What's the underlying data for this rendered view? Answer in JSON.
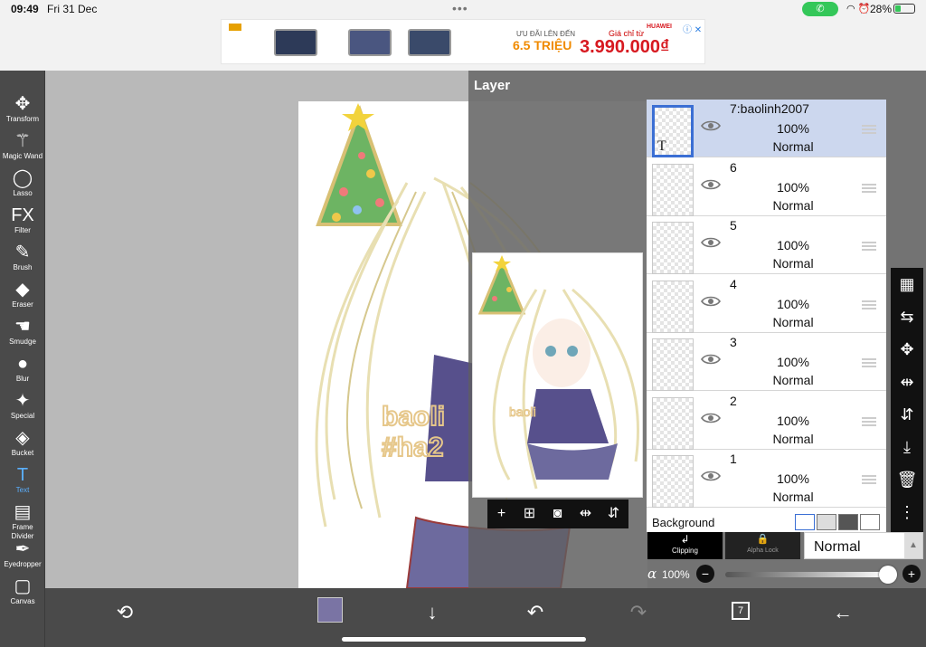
{
  "status_bar": {
    "time": "09:49",
    "date": "Fri 31 Dec",
    "battery": "28%",
    "battery_fraction": 0.28
  },
  "ad": {
    "promo_small": "ƯU ĐÃI LÊN ĐẾN",
    "promo_big": "6.5 TRIỆU",
    "price_small": "Giá chỉ từ",
    "price_big": "3.990.000₫",
    "brand": "HUAWEI",
    "accent": "#d71920"
  },
  "tools": [
    {
      "label": "Transform",
      "icon": "transform-icon",
      "glyph": "✥"
    },
    {
      "label": "Magic Wand",
      "icon": "magic-wand-icon",
      "glyph": "⚚"
    },
    {
      "label": "Lasso",
      "icon": "lasso-icon",
      "glyph": "◯"
    },
    {
      "label": "Filter",
      "icon": "filter-icon",
      "glyph": "FX"
    },
    {
      "label": "Brush",
      "icon": "brush-icon",
      "glyph": "✎"
    },
    {
      "label": "Eraser",
      "icon": "eraser-icon",
      "glyph": "◆"
    },
    {
      "label": "Smudge",
      "icon": "smudge-icon",
      "glyph": "☚"
    },
    {
      "label": "Blur",
      "icon": "blur-icon",
      "glyph": "●"
    },
    {
      "label": "Special",
      "icon": "special-icon",
      "glyph": "✦"
    },
    {
      "label": "Bucket",
      "icon": "bucket-icon",
      "glyph": "◈"
    },
    {
      "label": "Text",
      "icon": "text-icon",
      "glyph": "T",
      "active": true
    },
    {
      "label": "Frame Divider",
      "icon": "frame-divider-icon",
      "glyph": "▤"
    },
    {
      "label": "Eyedropper",
      "icon": "eyedropper-icon",
      "glyph": "✒"
    },
    {
      "label": "Canvas",
      "icon": "canvas-icon",
      "glyph": "▢"
    }
  ],
  "layer_panel": {
    "title": "Layer",
    "layers": [
      {
        "name": "7:baolinh2007",
        "opacity": "100%",
        "mode": "Normal",
        "selected": true
      },
      {
        "name": "6",
        "opacity": "100%",
        "mode": "Normal"
      },
      {
        "name": "5",
        "opacity": "100%",
        "mode": "Normal"
      },
      {
        "name": "4",
        "opacity": "100%",
        "mode": "Normal"
      },
      {
        "name": "3",
        "opacity": "100%",
        "mode": "Normal"
      },
      {
        "name": "2",
        "opacity": "100%",
        "mode": "Normal"
      },
      {
        "name": "1",
        "opacity": "100%",
        "mode": "Normal"
      }
    ],
    "background_label": "Background",
    "clipping_label": "Clipping",
    "alpha_lock_label": "Alpha Lock",
    "blend_mode": "Normal",
    "alpha_symbol": "α",
    "alpha_value": "100%",
    "alpha_fraction": 1.0
  },
  "canvas_text_line1": "baoli",
  "canvas_text_line2": "#ha2",
  "bottom": {
    "color": "#7a74a4",
    "layer_count": "7"
  }
}
